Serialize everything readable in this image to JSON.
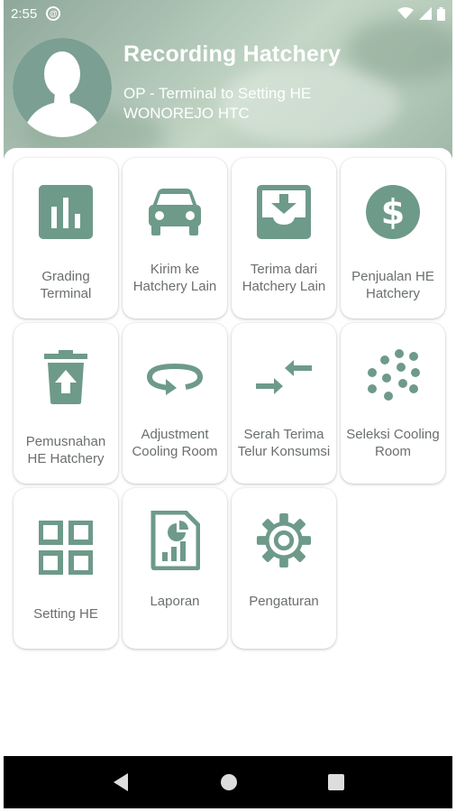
{
  "status_bar": {
    "time": "2:55",
    "icons": [
      "at-sign-icon",
      "wifi-icon",
      "signal-icon",
      "battery-icon"
    ]
  },
  "header": {
    "title": "Recording Hatchery",
    "subtitle_line1": "OP - Terminal to Setting HE",
    "subtitle_line2": "WONOREJO HTC",
    "avatar": "user-silhouette-icon"
  },
  "colors": {
    "icon": "#6e9a8a",
    "label": "#6a6f6d",
    "header_tint": "#a9c0b1"
  },
  "menu": [
    {
      "label": "Grading Terminal",
      "icon": "bar-chart-icon"
    },
    {
      "label": "Kirim ke Hatchery Lain",
      "icon": "car-icon"
    },
    {
      "label": "Terima dari Hatchery Lain",
      "icon": "inbox-download-icon"
    },
    {
      "label": "Penjualan HE Hatchery",
      "icon": "dollar-icon"
    },
    {
      "label": "Pemusnahan HE Hatchery",
      "icon": "trash-upload-icon"
    },
    {
      "label": "Adjustment Cooling Room",
      "icon": "rotate-icon"
    },
    {
      "label": "Serah Terima Telur Konsumsi",
      "icon": "compress-arrows-icon"
    },
    {
      "label": "Seleksi Cooling Room",
      "icon": "dots-grid-icon"
    },
    {
      "label": "Setting HE",
      "icon": "grid-squares-icon"
    },
    {
      "label": "Laporan",
      "icon": "report-icon"
    },
    {
      "label": "Pengaturan",
      "icon": "gear-icon"
    }
  ],
  "nav": {
    "buttons": [
      "back-icon",
      "home-icon",
      "recents-icon"
    ]
  }
}
